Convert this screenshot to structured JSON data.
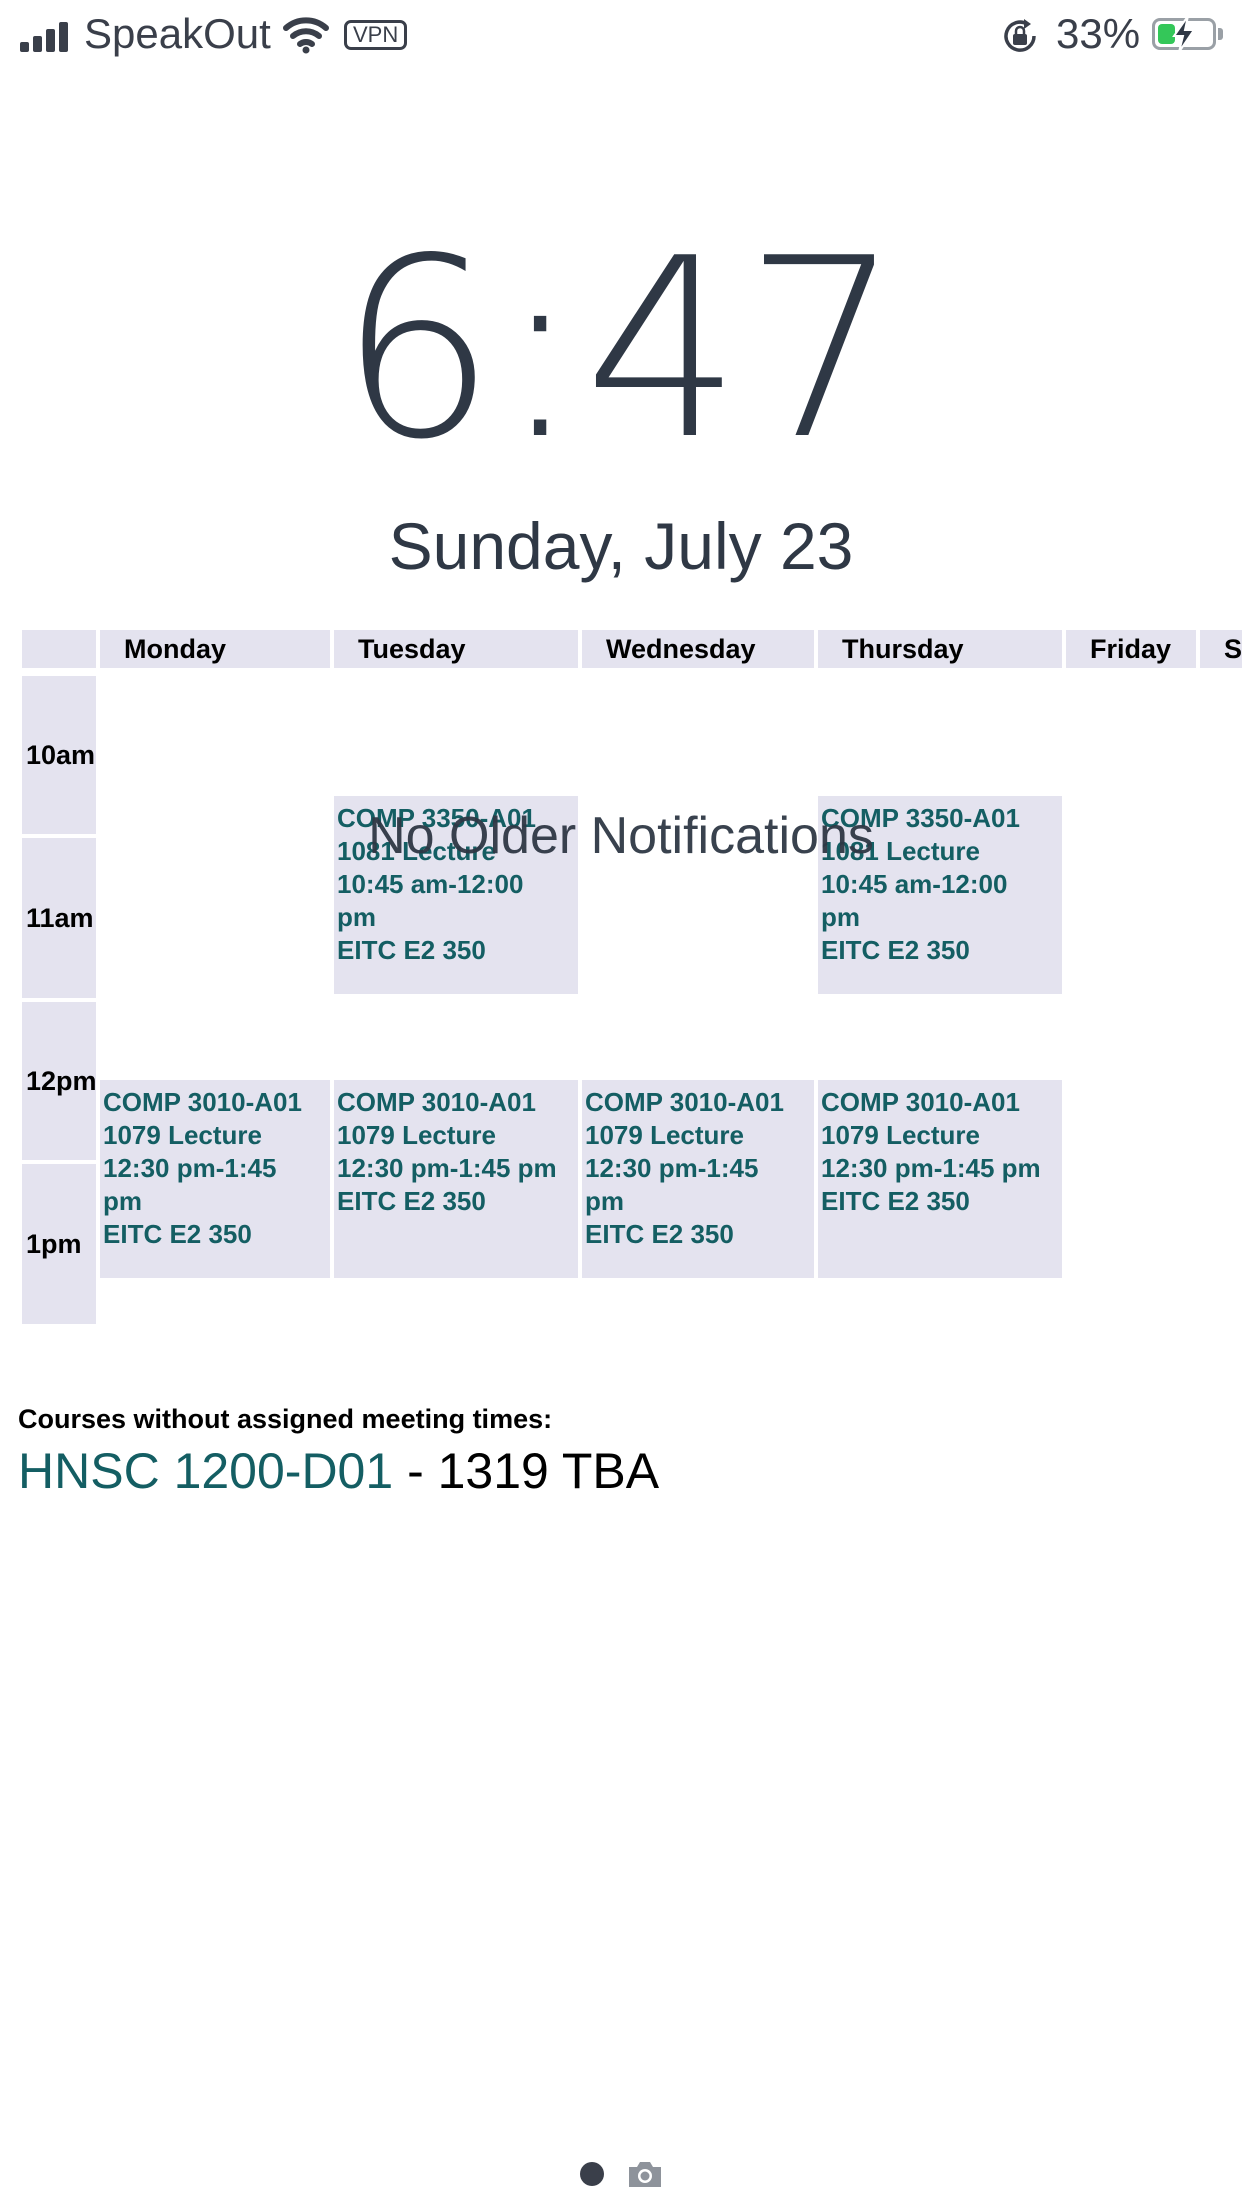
{
  "status_bar": {
    "carrier": "SpeakOut",
    "vpn_label": "VPN",
    "battery_percent": "33%",
    "battery_level": 0.33,
    "icons": [
      "signal-icon",
      "wifi-icon",
      "vpn-badge",
      "rotation-lock-icon",
      "battery-charging-icon"
    ]
  },
  "lock_screen": {
    "time": "6:47",
    "date": "Sunday, July 23",
    "notification_text": "No Older Notifications"
  },
  "schedule": {
    "days": [
      "Monday",
      "Tuesday",
      "Wednesday",
      "Thursday",
      "Friday",
      "Sa"
    ],
    "times": [
      "10am",
      "11am",
      "12pm",
      "1pm"
    ],
    "events": {
      "tue_comp3350": [
        "COMP 3350-A01",
        "1081 Lecture",
        "10:45 am-12:00",
        "pm",
        "EITC E2 350"
      ],
      "thu_comp3350": [
        "COMP 3350-A01",
        "1081 Lecture",
        "10:45 am-12:00",
        "pm",
        "EITC E2 350"
      ],
      "mon_comp3010": [
        "COMP 3010-A01",
        "1079 Lecture",
        "12:30 pm-1:45",
        "pm",
        "EITC E2 350"
      ],
      "tue_comp3010": [
        "COMP 3010-A01",
        "1079 Lecture",
        "12:30 pm-1:45 pm",
        "EITC E2 350"
      ],
      "wed_comp3010": [
        "COMP 3010-A01",
        "1079 Lecture",
        "12:30 pm-1:45",
        "pm",
        "EITC E2 350"
      ],
      "thu_comp3010": [
        "COMP 3010-A01",
        "1079 Lecture",
        "12:30 pm-1:45 pm",
        "EITC E2 350"
      ]
    }
  },
  "unassigned": {
    "label": "Courses without assigned meeting times:",
    "course_link": "HNSC 1200-D01",
    "course_rest": " - 1319 TBA"
  },
  "colors": {
    "event_bg": "#e4e3ef",
    "event_text": "#145e63",
    "lock_text": "#2f3845"
  }
}
